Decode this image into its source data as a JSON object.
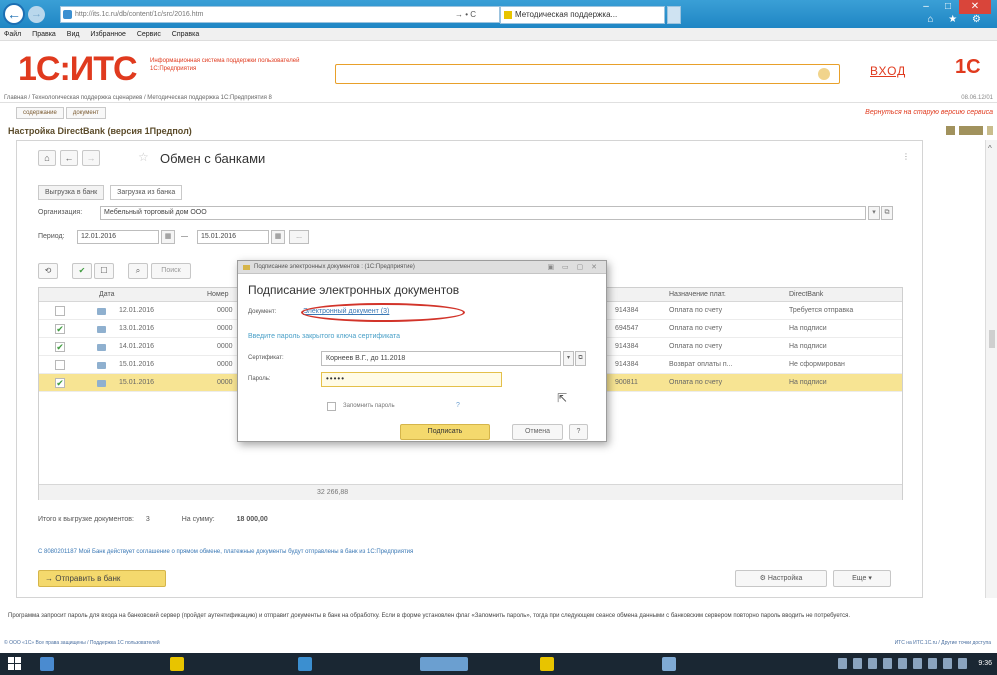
{
  "browser": {
    "url": "http://its.1c.ru/db/content/1c/src/2016.htm",
    "url_tools": "→ • C",
    "tab_label": "Методическая поддержка...",
    "menu": [
      "Файл",
      "Правка",
      "Вид",
      "Избранное",
      "Сервис",
      "Справка"
    ],
    "back_symbol": "←",
    "forward_symbol": "→",
    "win_minimize": "–",
    "win_maximize": "□",
    "win_close": "✕",
    "home_icons": "⌂ ★ ⚙"
  },
  "site": {
    "logo": "1С:ИТС",
    "logo_desc": "Информационная система поддержки пользователей 1С:Предприятия",
    "login": "ВХОД",
    "logo_right": "1С",
    "breadcrumbs": "Главная / Технологическая поддержка сценариев / Методическая поддержка 1С:Предприятия 8",
    "breadcrumbs_right": "08.06.12/01",
    "doc_tabs": [
      "содержание",
      "документ"
    ],
    "back_old": "Вернуться на старую версию сервиса",
    "page_heading": "Настройка DirectBank (версия 1Предпол)"
  },
  "form": {
    "title": "Обмен с банками",
    "tabs": [
      "Выгрузка в банк",
      "Загрузка из банка"
    ],
    "org_label": "Организация:",
    "org_value": "Мебельный торговый дом ООО",
    "period_label": "Период:",
    "date_from": "12.01.2016",
    "date_to": "15.01.2016",
    "dash": "—",
    "search_btn": "Поиск",
    "columns": [
      "Дата",
      "Номер",
      "Назначение плат.",
      "DirectBank"
    ],
    "rows": [
      {
        "checked": false,
        "date": "12.01.2016",
        "num": "0000",
        "acc": "914384",
        "purpose": "Оплата по счету",
        "status": "Требуется отправка",
        "selected": false
      },
      {
        "checked": true,
        "date": "13.01.2016",
        "num": "0000",
        "acc": "694547",
        "purpose": "Оплата по счету",
        "status": "На подписи",
        "selected": false
      },
      {
        "checked": true,
        "date": "14.01.2016",
        "num": "0000",
        "acc": "914384",
        "purpose": "Оплата по счету",
        "status": "На подписи",
        "selected": false
      },
      {
        "checked": false,
        "date": "15.01.2016",
        "num": "0000",
        "acc": "914384",
        "purpose": "Возврат оплаты п...",
        "status": "Не сформирован",
        "selected": false
      },
      {
        "checked": true,
        "date": "15.01.2016",
        "num": "0000",
        "acc": "900811",
        "purpose": "Оплата по счету",
        "status": "На подписи",
        "selected": true
      }
    ],
    "grid_total": "32 266,88",
    "summary_docs_label": "Итого к выгрузке документов:",
    "summary_docs_value": "3",
    "summary_sum_label": "На сумму:",
    "summary_sum_value": "18 000,00",
    "info_note": "С 8080201187 Мой Банк действует соглашение о прямом обмене, платежные документы будут отправлены в банк из 1С:Предприятия",
    "send_button": "Отправить в банк",
    "settings_button": "Настройка",
    "more_button": "Еще"
  },
  "dialog": {
    "title": "Подписание электронных документов : (1С:Предприятие)",
    "heading": "Подписание электронных документов",
    "doc_label": "Документ:",
    "doc_link": "Электронный документ (3)",
    "prompt": "Введите пароль закрытого ключа сертификата",
    "cert_label": "Сертификат:",
    "cert_value": "Корнеев В.Г., до 11.2018",
    "pwd_label": "Пароль:",
    "pwd_value": "•••••",
    "remember_label": "Запомнить пароль",
    "help_q": "?",
    "sign_button": "Подписать",
    "cancel_button": "Отмена",
    "help_button": "?"
  },
  "bottom_note": "Программа запросит пароль для входа на банковский сервер (пройдет аутентификацию) и отправит документы в банк на обработку. Если в форме установлен флаг «Запомнить пароль», тогда при следующем сеансе обмена данными с банковским сервером повторно пароль вводить не потребуется.",
  "status_left": "© ООО «1С» Все права защищены / Поддержка 1С пользователей",
  "status_right": "ИТС на ИТС.1С.ru / Другие точки доступа",
  "clock": "9:36",
  "colors": {
    "accent": "#e03a1e",
    "yellow": "#f4d96d",
    "link": "#3a78b5"
  }
}
